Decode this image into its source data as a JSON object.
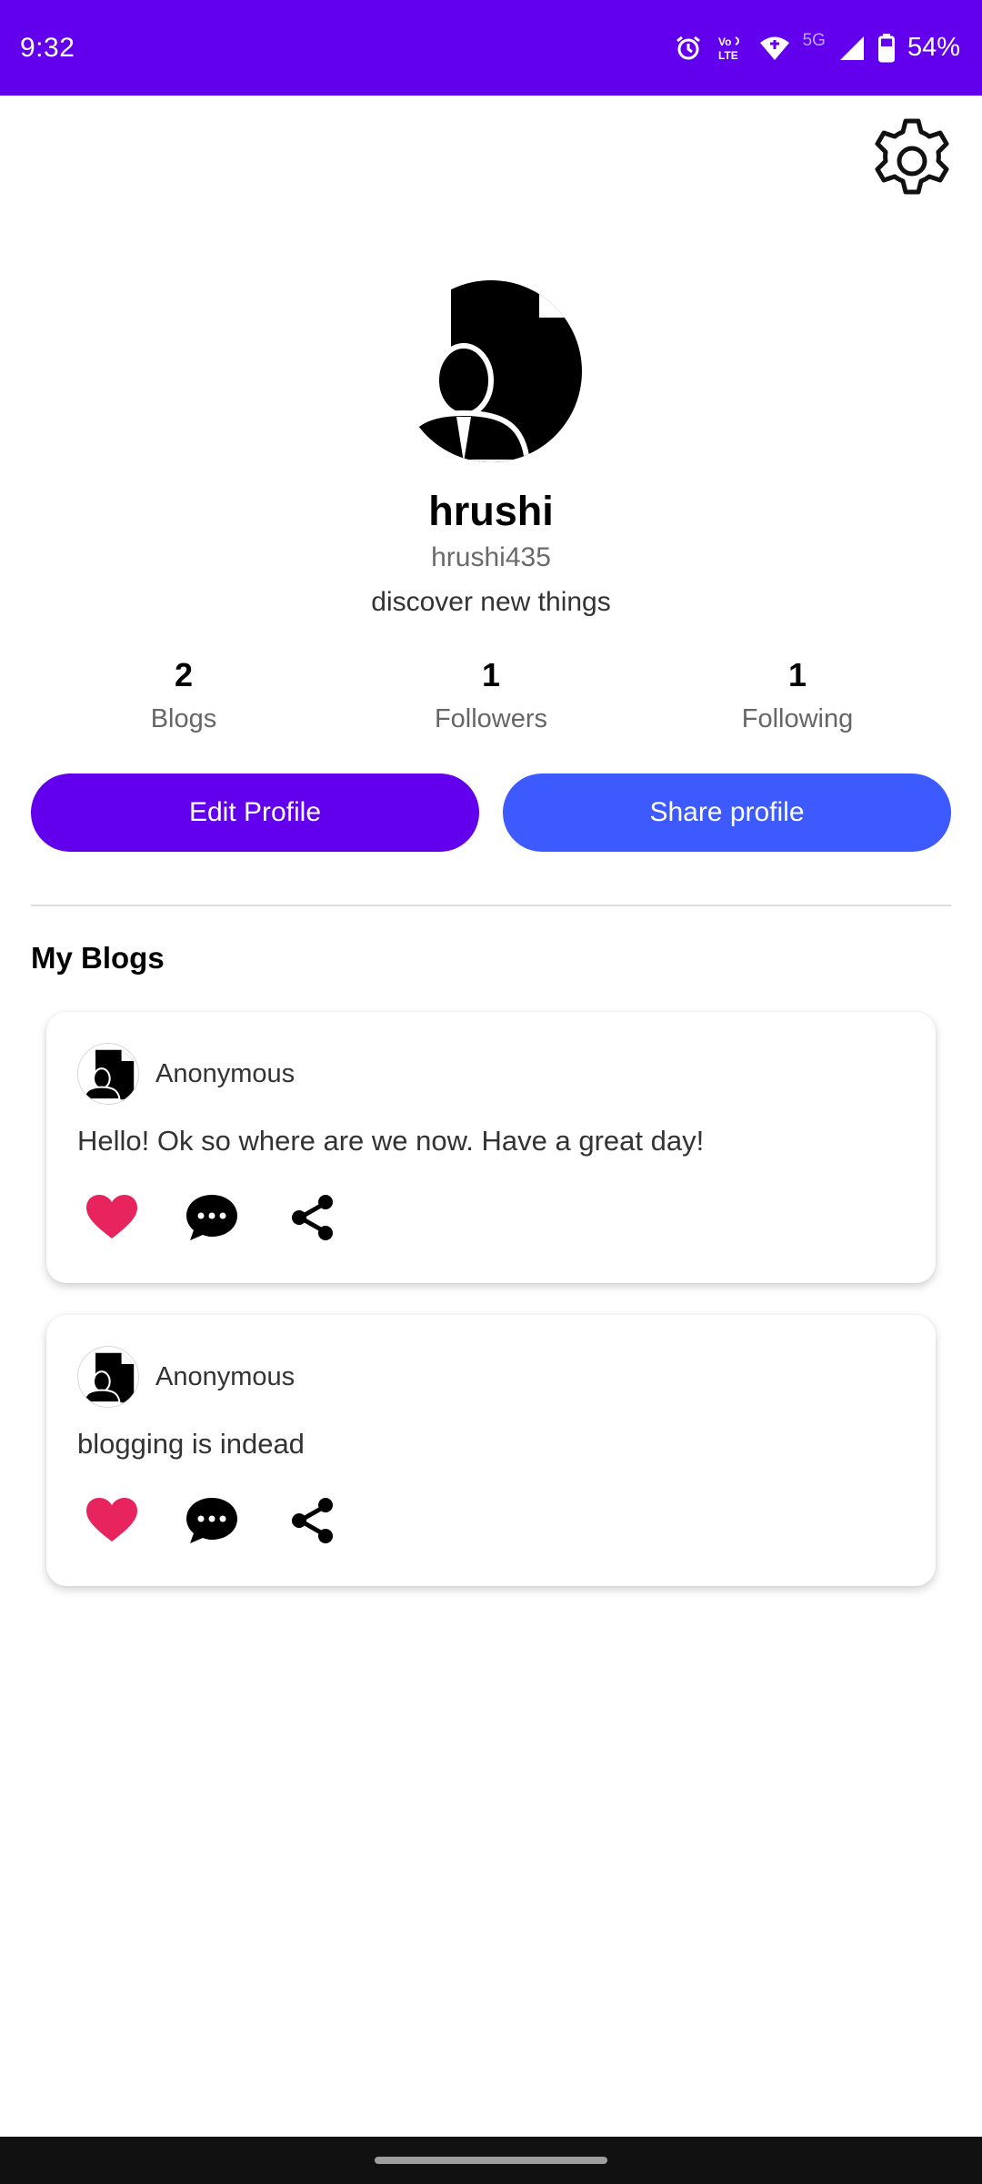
{
  "status_bar": {
    "time": "9:32",
    "network_label": "5G",
    "battery": "54%",
    "icons": [
      "alarm-icon",
      "volte-icon",
      "wifi-icon",
      "signal-icon",
      "battery-icon"
    ]
  },
  "settings": {
    "icon": "gear-icon"
  },
  "profile": {
    "name": "hrushi",
    "username": "hrushi435",
    "bio": "discover new things",
    "avatar_icon": "user-document-icon"
  },
  "stats": [
    {
      "count": "2",
      "label": "Blogs"
    },
    {
      "count": "1",
      "label": "Followers"
    },
    {
      "count": "1",
      "label": "Following"
    }
  ],
  "buttons": {
    "edit_label": "Edit Profile",
    "share_label": "Share profile"
  },
  "colors": {
    "primary": "#6200EE",
    "share": "#3D5AFE",
    "like": "#E8245F"
  },
  "section_title": "My Blogs",
  "blogs": [
    {
      "author": "Anonymous",
      "text": "Hello! Ok so where are we now. Have a great day!"
    },
    {
      "author": "Anonymous",
      "text": "blogging is indead"
    }
  ]
}
